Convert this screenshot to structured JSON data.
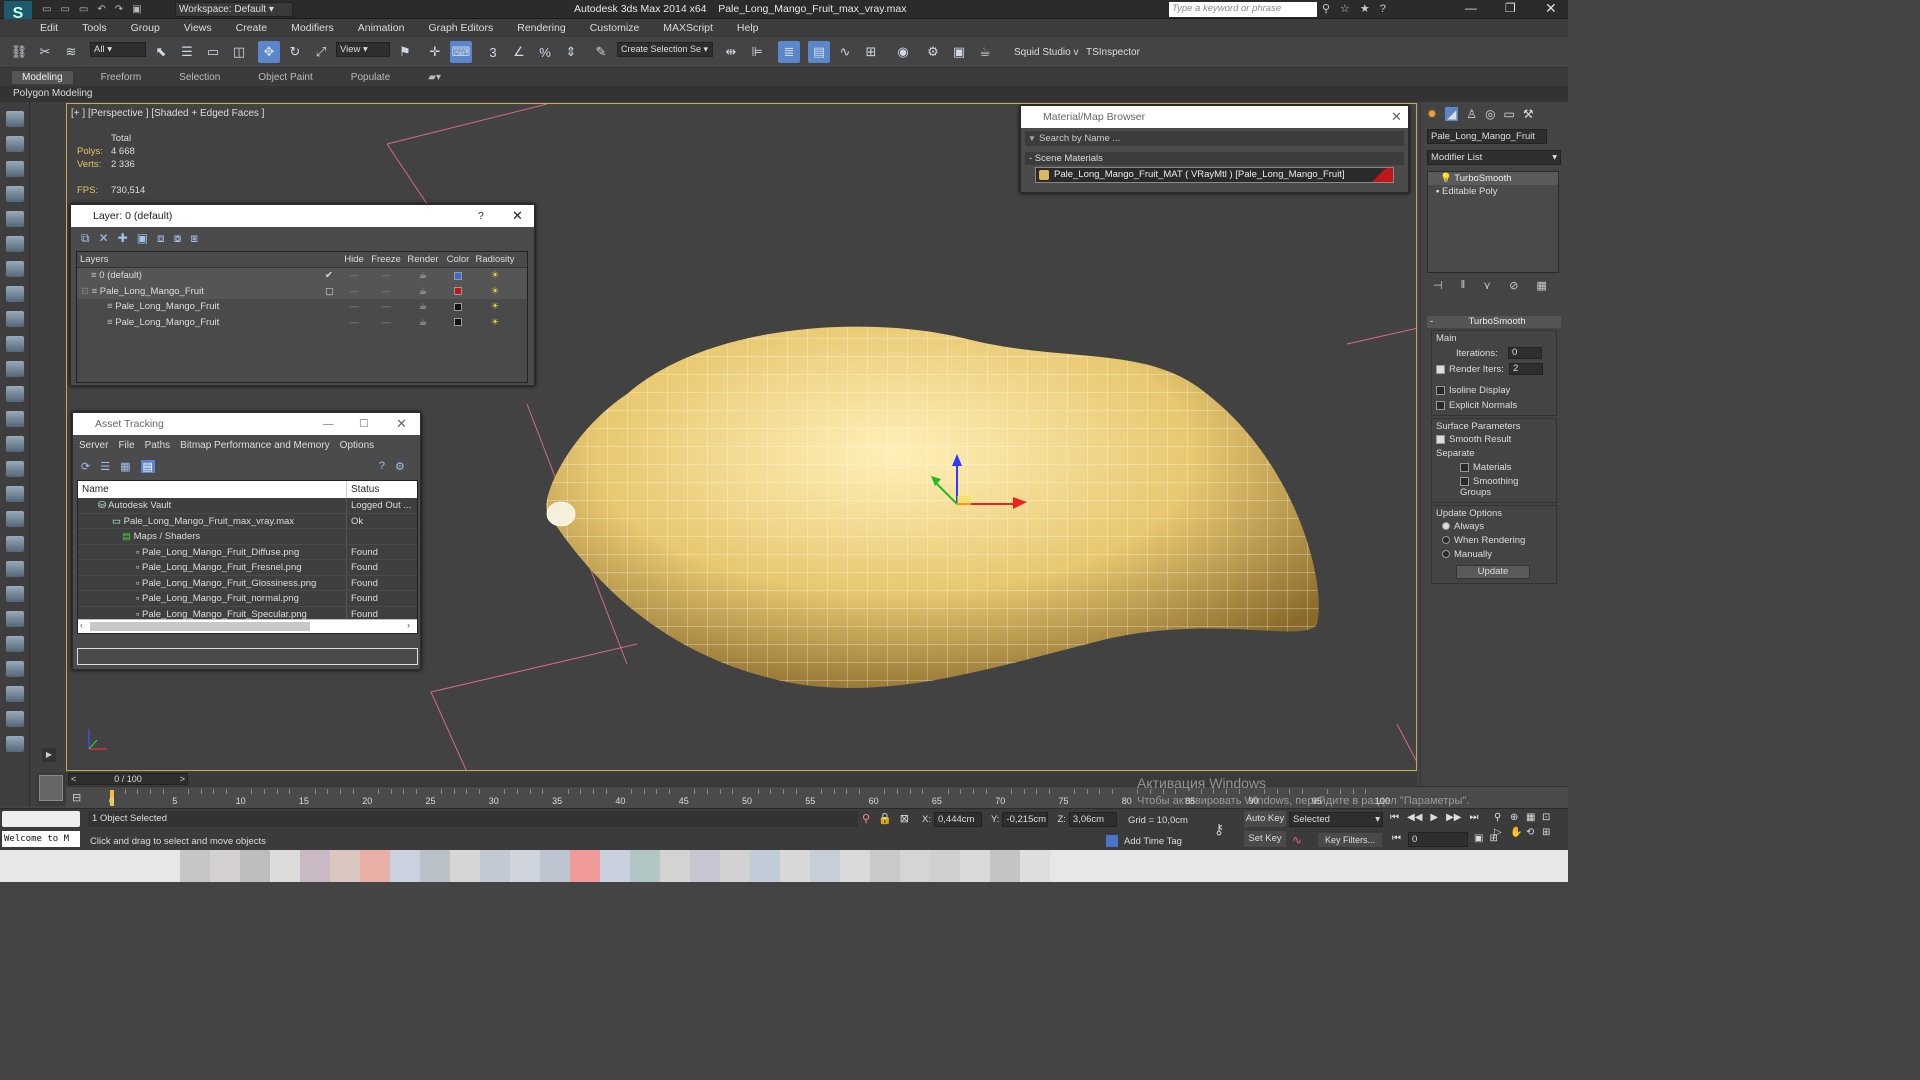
{
  "title": {
    "workspace": "Workspace: Default",
    "app": "Autodesk 3ds Max  2014 x64",
    "file": "Pale_Long_Mango_Fruit_max_vray.max",
    "search_placeholder": "Type a keyword or phrase"
  },
  "menu": [
    "Edit",
    "Tools",
    "Group",
    "Views",
    "Create",
    "Modifiers",
    "Animation",
    "Graph Editors",
    "Rendering",
    "Customize",
    "MAXScript",
    "Help"
  ],
  "toolbar": {
    "selection_filter": "All",
    "ref_coord": "View",
    "named_selection": "Create Selection Se",
    "squid": "Squid Studio v",
    "tsinspector": "TSInspector"
  },
  "ribbon": {
    "tabs": [
      "Modeling",
      "Freeform",
      "Selection",
      "Object Paint",
      "Populate"
    ],
    "panel": "Polygon Modeling"
  },
  "viewport": {
    "label": "[+ ] [Perspective ] [Shaded + Edged Faces ]",
    "stats_header": "Total",
    "polys_label": "Polys:",
    "polys": "4 668",
    "verts_label": "Verts:",
    "verts": "2 336",
    "fps_label": "FPS:",
    "fps": "730,514"
  },
  "layer_dialog": {
    "title": "Layer: 0 (default)",
    "columns": [
      "Layers",
      "Hide",
      "Freeze",
      "Render",
      "Color",
      "Radiosity"
    ],
    "rows": [
      {
        "name": "0 (default)",
        "color": "#3a6ad8"
      },
      {
        "name": "Pale_Long_Mango_Fruit",
        "color": "#c01818"
      },
      {
        "name": "Pale_Long_Mango_Fruit",
        "color": "#111111"
      },
      {
        "name": "Pale_Long_Mango_Fruit",
        "color": "#111111"
      }
    ]
  },
  "asset_tracking": {
    "title": "Asset Tracking",
    "menu": [
      "Server",
      "File",
      "Paths",
      "Bitmap Performance and Memory",
      "Options"
    ],
    "columns": [
      "Name",
      "Status"
    ],
    "rows": [
      {
        "name": "Autodesk Vault",
        "status": "Logged Out ..."
      },
      {
        "name": "Pale_Long_Mango_Fruit_max_vray.max",
        "status": "Ok"
      },
      {
        "name": "Maps / Shaders",
        "status": ""
      },
      {
        "name": "Pale_Long_Mango_Fruit_Diffuse.png",
        "status": "Found"
      },
      {
        "name": "Pale_Long_Mango_Fruit_Fresnel.png",
        "status": "Found"
      },
      {
        "name": "Pale_Long_Mango_Fruit_Glossiness.png",
        "status": "Found"
      },
      {
        "name": "Pale_Long_Mango_Fruit_normal.png",
        "status": "Found"
      },
      {
        "name": "Pale_Long_Mango_Fruit_Specular.png",
        "status": "Found"
      }
    ]
  },
  "material_browser": {
    "title": "Material/Map Browser",
    "search_placeholder": "Search by Name ...",
    "group": "- Scene Materials",
    "item": "Pale_Long_Mango_Fruit_MAT ( VRayMtl ) [Pale_Long_Mango_Fruit]"
  },
  "command_panel": {
    "object_name": "Pale_Long_Mango_Fruit",
    "modifier_list": "Modifier List",
    "stack": [
      "TurboSmooth",
      "Editable Poly"
    ],
    "rollout": "TurboSmooth",
    "main": "Main",
    "iterations_label": "Iterations:",
    "iterations": "0",
    "render_iters_label": "Render Iters:",
    "render_iters": "2",
    "isoline": "Isoline Display",
    "explicit_normals": "Explicit Normals",
    "surface_params": "Surface Parameters",
    "smooth_result": "Smooth Result",
    "separate": "Separate",
    "materials": "Materials",
    "smoothing_groups": "Smoothing Groups",
    "update_options": "Update Options",
    "always": "Always",
    "when_rendering": "When Rendering",
    "manually": "Manually",
    "update_btn": "Update"
  },
  "timeline": {
    "frame": "0 / 100",
    "ticks": [
      "0",
      "5",
      "10",
      "15",
      "20",
      "25",
      "30",
      "35",
      "40",
      "45",
      "50",
      "55",
      "60",
      "65",
      "70",
      "75",
      "80",
      "85",
      "90",
      "95",
      "100"
    ]
  },
  "status": {
    "selected": "1 Object Selected",
    "prompt": "Click and drag to select and move objects",
    "welcome": "Welcome to M",
    "x_label": "X:",
    "x": "0,444cm",
    "y_label": "Y:",
    "y": "-0,215cm",
    "z_label": "Z:",
    "z": "3,06cm",
    "grid": "Grid = 10,0cm",
    "add_time_tag": "Add Time Tag",
    "auto_key": "Auto Key",
    "set_key": "Set Key",
    "selected_dd": "Selected",
    "key_filters": "Key Filters...",
    "frame_field": "0"
  },
  "watermark": {
    "line1": "Активация Windows",
    "line2": "Чтобы активировать Windows, перейдите в раздел \"Параметры\"."
  }
}
